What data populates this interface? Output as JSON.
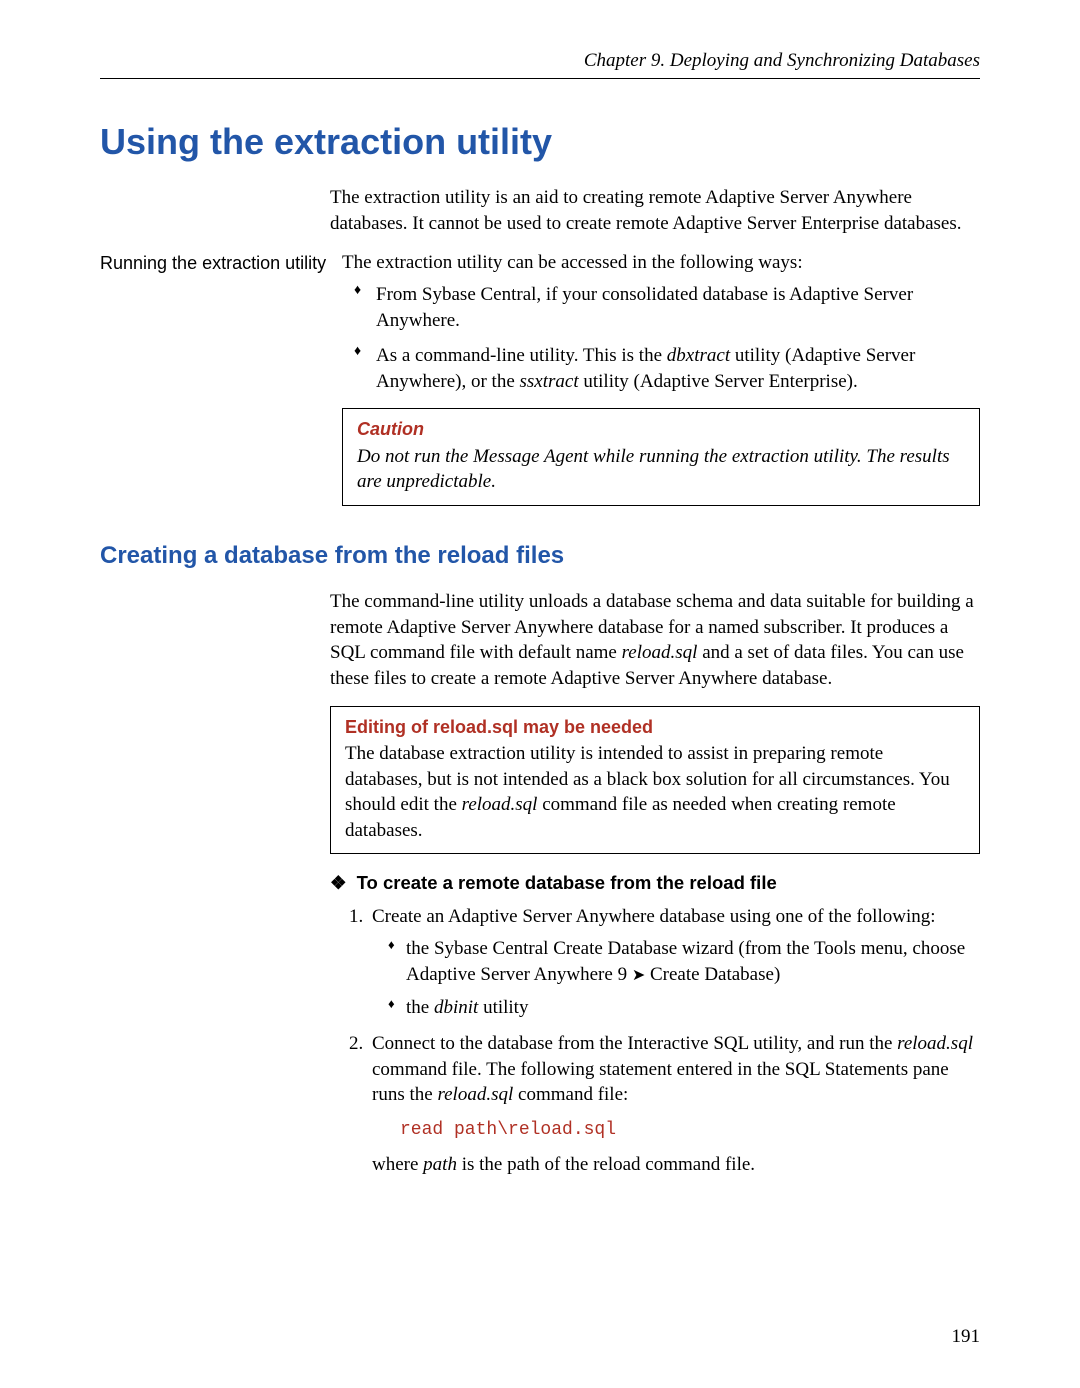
{
  "header": {
    "chapter": "Chapter 9.   Deploying and Synchronizing Databases"
  },
  "h1": "Using the extraction utility",
  "intro": "The extraction utility is an aid to creating remote Adaptive Server Anywhere databases. It cannot be used to create remote Adaptive Server Enterprise databases.",
  "section1": {
    "side_label": "Running the extraction utility",
    "lead": "The extraction utility can be accessed in the following ways:",
    "bullets": {
      "b1": "From Sybase Central, if your consolidated database is Adaptive Server Anywhere.",
      "b2_pre": "As a command-line utility. This is the ",
      "b2_util1": "dbxtract",
      "b2_mid": " utility (Adaptive Server Anywhere), or the ",
      "b2_util2": "ssxtract",
      "b2_post": " utility (Adaptive Server Enterprise)."
    }
  },
  "caution": {
    "title": "Caution",
    "body": "Do not run the Message Agent while running the extraction utility.  The results are unpredictable."
  },
  "h2": "Creating a database from the reload files",
  "para2_pre": "The command-line utility unloads a database schema and data suitable for building a remote Adaptive Server Anywhere database for a named subscriber. It produces a SQL command file with default name ",
  "para2_file": "reload.sql",
  "para2_post": " and a set of data files. You can use these files to create a remote Adaptive Server Anywhere database.",
  "editbox": {
    "title": "Editing of reload.sql may be needed",
    "body_pre": "The database extraction utility is intended to assist in preparing remote databases, but is not intended as a black box solution for all circumstances. You should edit the ",
    "body_file": "reload.sql",
    "body_post": " command file as needed when creating remote databases."
  },
  "proc": {
    "title": "To create a remote database from the reload file",
    "step1_lead": "Create an Adaptive Server Anywhere database using one of the following:",
    "step1_b1_pre": "the Sybase Central Create Database wizard (from the Tools menu, choose Adaptive Server Anywhere 9 ",
    "step1_b1_post": " Create Database)",
    "step1_b2_pre": "the ",
    "step1_b2_util": "dbinit",
    "step1_b2_post": " utility",
    "step2_pre": "Connect to the database from the Interactive SQL utility, and run the ",
    "step2_file1": "reload.sql",
    "step2_mid": " command file. The following statement entered in the SQL Statements pane runs the ",
    "step2_file2": "reload.sql",
    "step2_post": " command file:",
    "code": "read path\\reload.sql",
    "after_pre": "where ",
    "after_path": "path",
    "after_post": " is the path of the reload command file."
  },
  "page_number": "191"
}
